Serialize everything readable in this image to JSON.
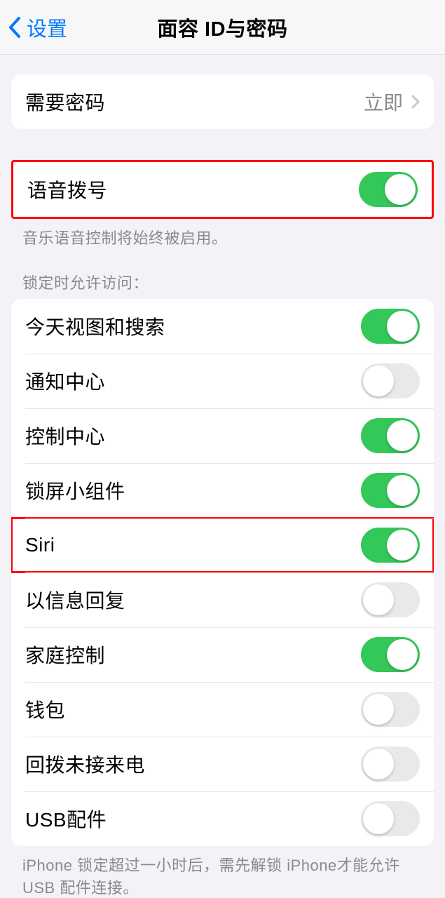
{
  "nav": {
    "back_label": "设置",
    "title": "面容 ID与密码"
  },
  "passcode_group": {
    "require_passcode": {
      "label": "需要密码",
      "value": "立即"
    }
  },
  "voice_dial": {
    "label": "语音拨号",
    "on": true,
    "footer": "音乐语音控制将始终被启用。"
  },
  "lock_access": {
    "header": "锁定时允许访问：",
    "items": [
      {
        "label": "今天视图和搜索",
        "on": true
      },
      {
        "label": "通知中心",
        "on": false
      },
      {
        "label": "控制中心",
        "on": true
      },
      {
        "label": "锁屏小组件",
        "on": true
      },
      {
        "label": "Siri",
        "on": true
      },
      {
        "label": "以信息回复",
        "on": false
      },
      {
        "label": "家庭控制",
        "on": true
      },
      {
        "label": "钱包",
        "on": false
      },
      {
        "label": "回拨未接来电",
        "on": false
      },
      {
        "label": "USB配件",
        "on": false
      }
    ],
    "footer": "iPhone 锁定超过一小时后，需先解锁 iPhone才能允许USB 配件连接。"
  }
}
